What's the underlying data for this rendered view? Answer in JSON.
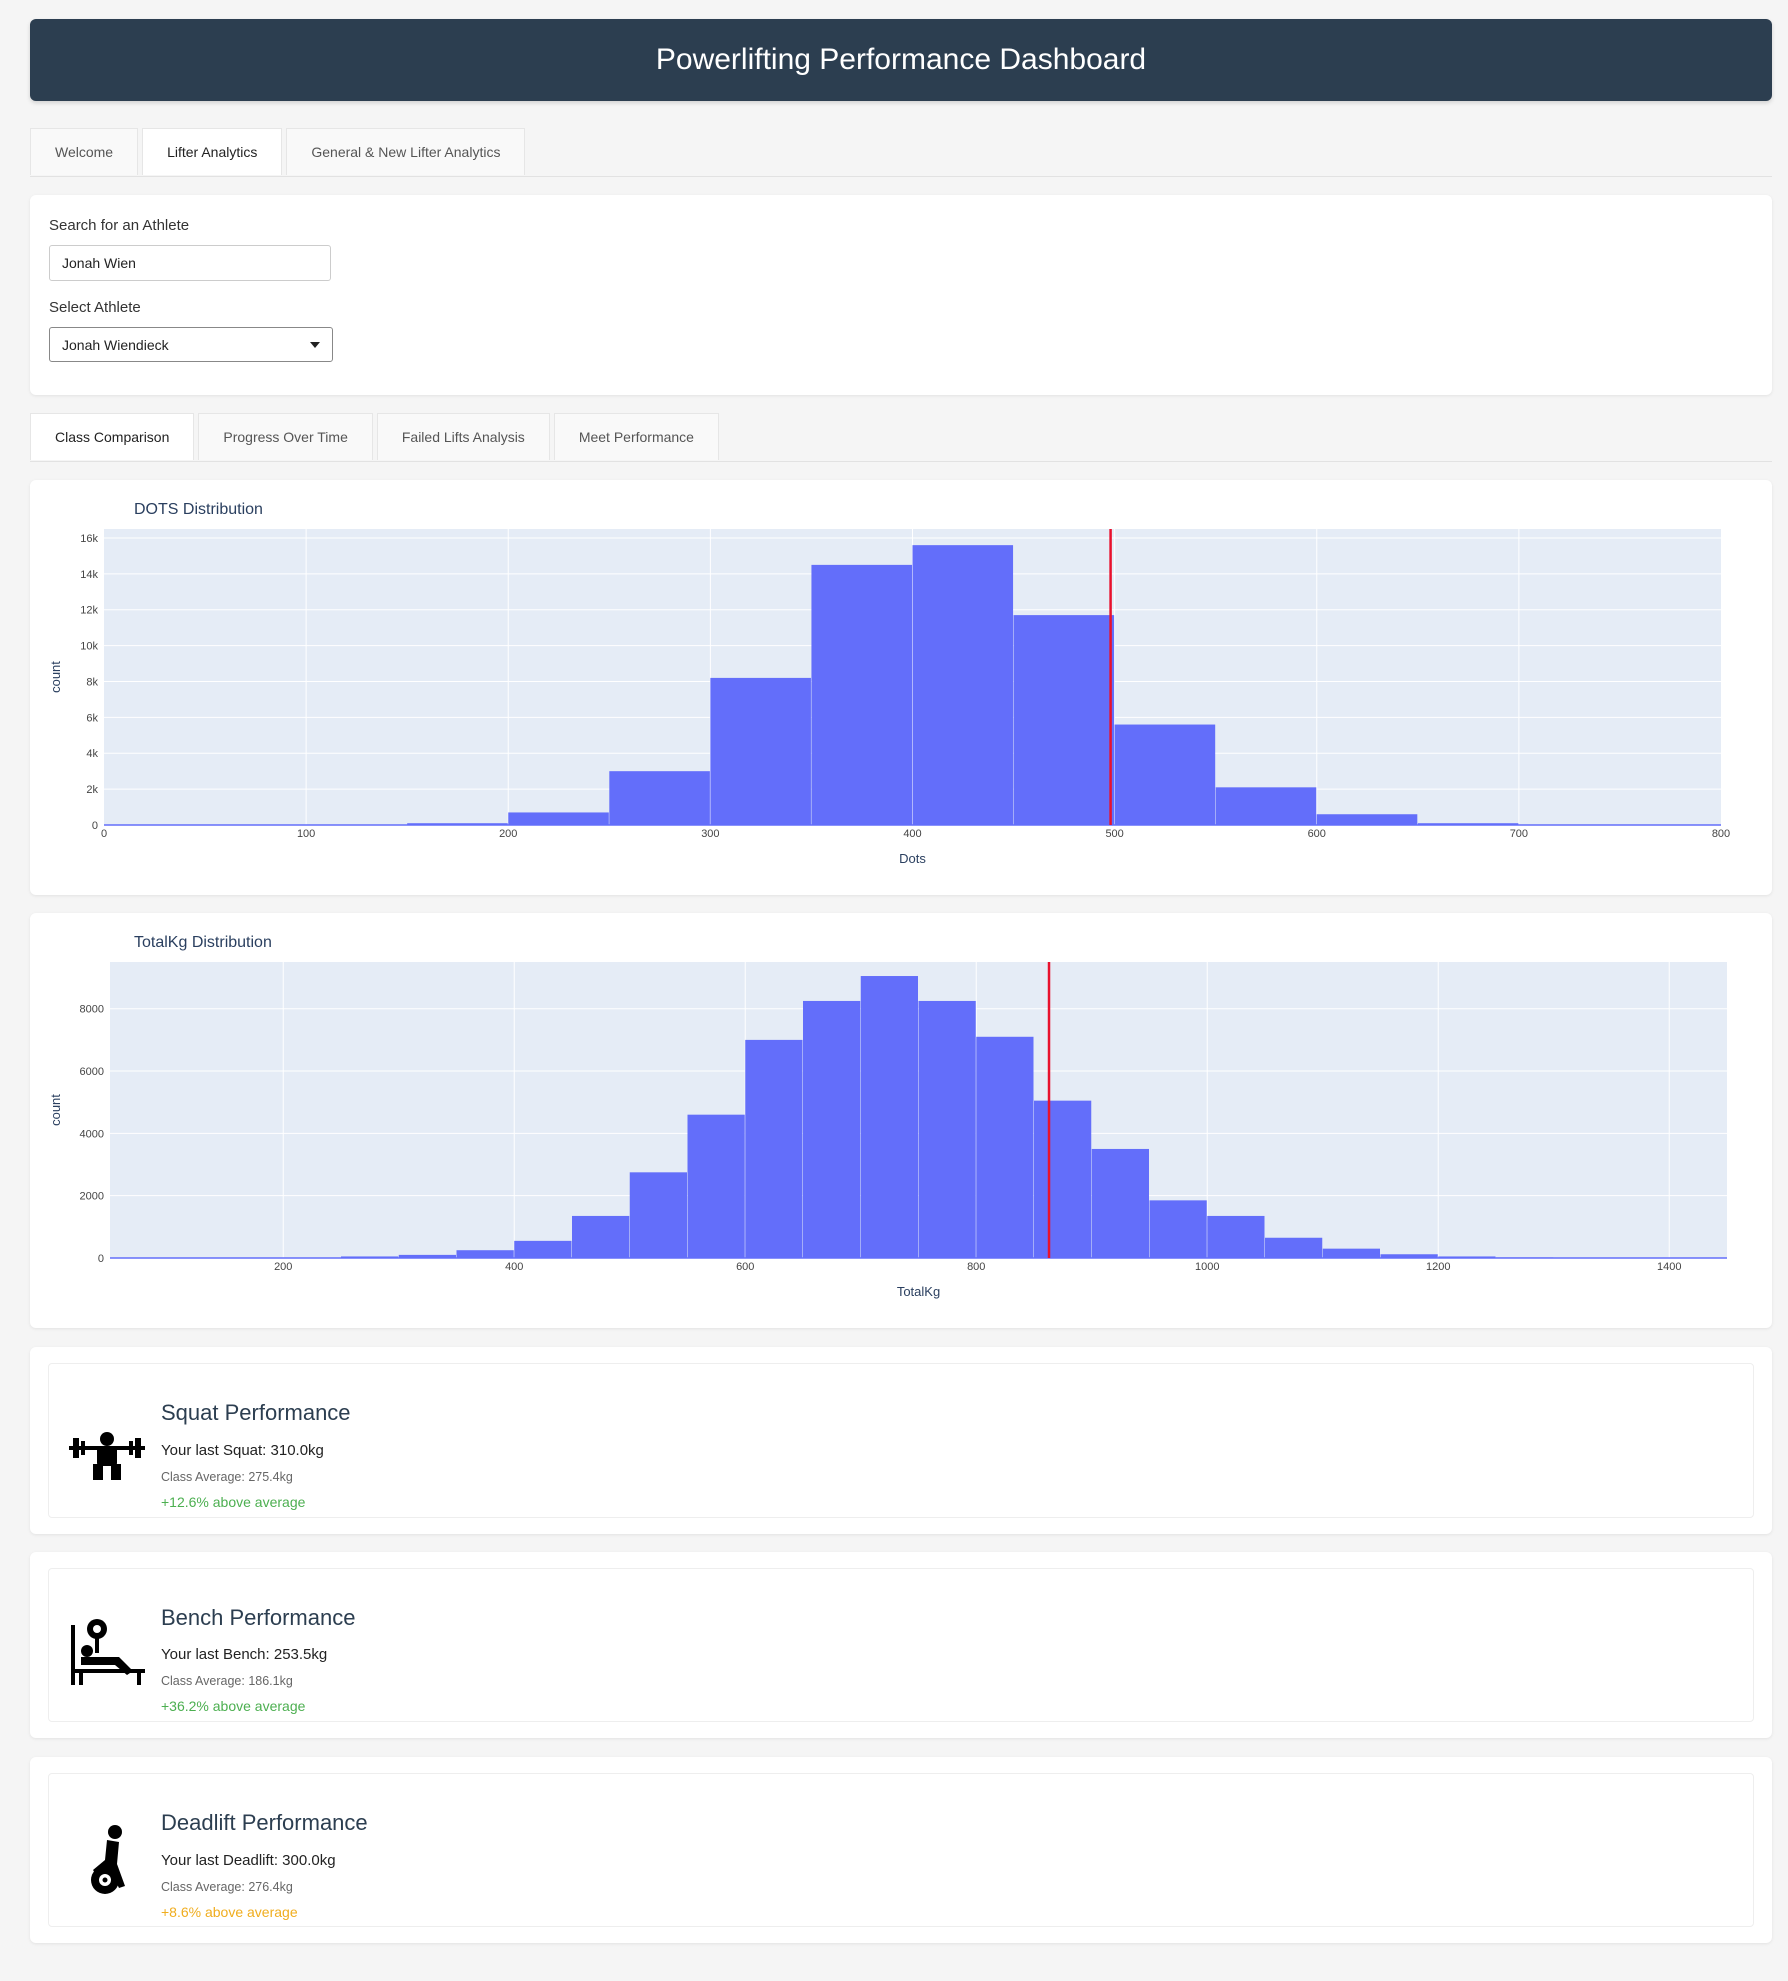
{
  "header": {
    "title": "Powerlifting Performance Dashboard"
  },
  "main_tabs": [
    {
      "label": "Welcome",
      "active": false
    },
    {
      "label": "Lifter Analytics",
      "active": true
    },
    {
      "label": "General & New Lifter Analytics",
      "active": false
    }
  ],
  "search": {
    "label": "Search for an Athlete",
    "value": "Jonah Wien",
    "select_label": "Select Athlete",
    "selected": "Jonah Wiendieck"
  },
  "sub_tabs": [
    {
      "label": "Class Comparison",
      "active": true
    },
    {
      "label": "Progress Over Time",
      "active": false
    },
    {
      "label": "Failed Lifts Analysis",
      "active": false
    },
    {
      "label": "Meet Performance",
      "active": false
    }
  ],
  "colors": {
    "bar": "#636efa",
    "plot_bg": "#e5ecf6",
    "marker_line": "#e8112d",
    "above_good": "#4caf50",
    "above_mild": "#f0ad1e"
  },
  "chart_data": [
    {
      "type": "bar",
      "title": "DOTS Distribution",
      "xlabel": "Dots",
      "ylabel": "count",
      "bin_start": 0,
      "bin_width": 50,
      "values": [
        0,
        0,
        0,
        100,
        700,
        3000,
        8200,
        14500,
        15600,
        11700,
        5600,
        2100,
        600,
        100,
        0,
        0
      ],
      "xlim": [
        0,
        800
      ],
      "ylim": [
        0,
        16500
      ],
      "xticks": [
        0,
        100,
        200,
        300,
        400,
        500,
        600,
        700,
        800
      ],
      "xtick_labels": [
        "0",
        "100",
        "200",
        "300",
        "400",
        "500",
        "600",
        "700",
        "800"
      ],
      "yticks": [
        0,
        2000,
        4000,
        6000,
        8000,
        10000,
        12000,
        14000,
        16000
      ],
      "ytick_labels": [
        "0",
        "2k",
        "4k",
        "6k",
        "8k",
        "10k",
        "12k",
        "14k",
        "16k"
      ],
      "marker_x": 498,
      "grid": true
    },
    {
      "type": "bar",
      "title": "TotalKg Distribution",
      "xlabel": "TotalKg",
      "ylabel": "count",
      "bin_start": 50,
      "bin_width": 50,
      "values": [
        0,
        0,
        0,
        0,
        50,
        100,
        250,
        550,
        1350,
        2750,
        4600,
        7000,
        8250,
        9050,
        8250,
        7100,
        5050,
        3500,
        1850,
        1350,
        650,
        300,
        120,
        50,
        20,
        0,
        0,
        0
      ],
      "xlim": [
        50,
        1450
      ],
      "ylim": [
        0,
        9500
      ],
      "xticks": [
        200,
        400,
        600,
        800,
        1000,
        1200,
        1400
      ],
      "xtick_labels": [
        "200",
        "400",
        "600",
        "800",
        "1000",
        "1200",
        "1400"
      ],
      "yticks": [
        0,
        2000,
        4000,
        6000,
        8000
      ],
      "ytick_labels": [
        "0",
        "2000",
        "4000",
        "6000",
        "8000"
      ],
      "marker_x": 863,
      "grid": true
    }
  ],
  "performance": [
    {
      "title": "Squat Performance",
      "last": "Your last Squat: 310.0kg",
      "avg": "Class Average: 275.4kg",
      "diff": "+12.6% above average",
      "diff_color": "#4caf50",
      "icon": "squat-icon"
    },
    {
      "title": "Bench Performance",
      "last": "Your last Bench: 253.5kg",
      "avg": "Class Average: 186.1kg",
      "diff": "+36.2% above average",
      "diff_color": "#4caf50",
      "icon": "bench-press-icon"
    },
    {
      "title": "Deadlift Performance",
      "last": "Your last Deadlift: 300.0kg",
      "avg": "Class Average: 276.4kg",
      "diff": "+8.6% above average",
      "diff_color": "#f0ad1e",
      "icon": "deadlift-icon"
    }
  ]
}
